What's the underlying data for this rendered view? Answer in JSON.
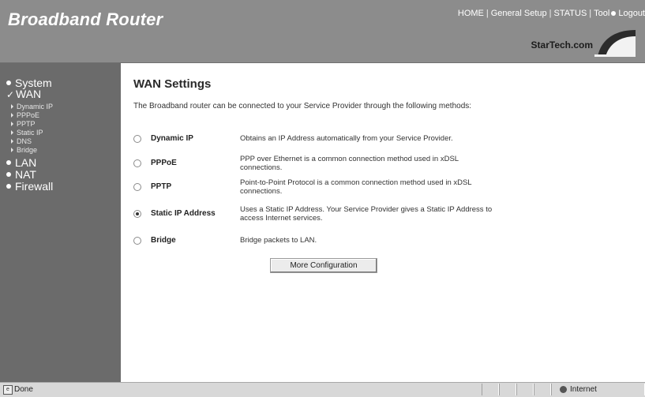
{
  "header": {
    "brand": "Broadband Router",
    "nav": [
      {
        "label": "HOME"
      },
      {
        "label": "General Setup"
      },
      {
        "label": "STATUS"
      },
      {
        "label": "Tool"
      },
      {
        "label": "Logout"
      }
    ],
    "logo_text": "StarTech.com"
  },
  "sidebar": {
    "items": [
      {
        "label": "System"
      },
      {
        "label": "WAN",
        "expanded": true
      },
      {
        "label": "LAN"
      },
      {
        "label": "NAT"
      },
      {
        "label": "Firewall"
      }
    ],
    "wan_subitems": [
      "Dynamic IP",
      "PPPoE",
      "PPTP",
      "Static IP",
      "DNS",
      "Bridge"
    ]
  },
  "main": {
    "title": "WAN Settings",
    "intro": "The Broadband router can be connected to your Service Provider through the following methods:",
    "options": [
      {
        "label": "Dynamic IP",
        "desc": "Obtains an IP Address automatically from your Service Provider.",
        "selected": false
      },
      {
        "label": "PPPoE",
        "desc": "PPP over Ethernet is a common connection method used in xDSL connections.",
        "selected": false
      },
      {
        "label": "PPTP",
        "desc": "Point-to-Point Protocol is a common connection method used in xDSL connections.",
        "selected": false
      },
      {
        "label": "Static IP Address",
        "desc": "Uses a Static IP Address. Your Service Provider gives a Static IP Address to access Internet services.",
        "selected": true
      },
      {
        "label": "Bridge",
        "desc": "Bridge packets to LAN.",
        "selected": false
      }
    ],
    "more_button": "More Configuration"
  },
  "statusbar": {
    "status": "Done",
    "zone": "Internet"
  },
  "colors": {
    "header_bg": "#8c8c8c",
    "sidebar_bg": "#6b6b6b",
    "statusbar_bg": "#d8d8d8"
  }
}
